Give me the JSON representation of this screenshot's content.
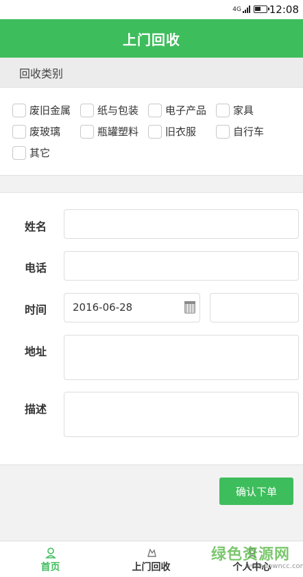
{
  "status_bar": {
    "network": "4G",
    "time": "12:08"
  },
  "header": {
    "title": "上门回收"
  },
  "category_section": {
    "title": "回收类别",
    "items": [
      {
        "label": "废旧金属",
        "checked": false
      },
      {
        "label": "纸与包装",
        "checked": false
      },
      {
        "label": "电子产品",
        "checked": false
      },
      {
        "label": "家具",
        "checked": false
      },
      {
        "label": "废玻璃",
        "checked": false
      },
      {
        "label": "瓶罐塑料",
        "checked": false
      },
      {
        "label": "旧衣服",
        "checked": false
      },
      {
        "label": "自行车",
        "checked": false
      },
      {
        "label": "其它",
        "checked": false
      }
    ]
  },
  "form": {
    "name_label": "姓名",
    "name_value": "",
    "phone_label": "电话",
    "phone_value": "",
    "time_label": "时间",
    "date_value": "2016-06-28",
    "time_value": "",
    "address_label": "地址",
    "address_value": "",
    "description_label": "描述",
    "description_value": ""
  },
  "confirm_button": "确认下单",
  "tabbar": {
    "items": [
      {
        "label": "首页",
        "icon": "user-outline-icon",
        "active": true
      },
      {
        "label": "上门回收",
        "icon": "recycle-icon",
        "active": false
      },
      {
        "label": "个人中心",
        "icon": "person-icon",
        "active": false
      }
    ]
  },
  "watermark": {
    "cn": "绿色资源网",
    "en": "www.downcc.com"
  },
  "colors": {
    "brand_green": "#3ebd5c",
    "background": "#f2f2f2"
  }
}
